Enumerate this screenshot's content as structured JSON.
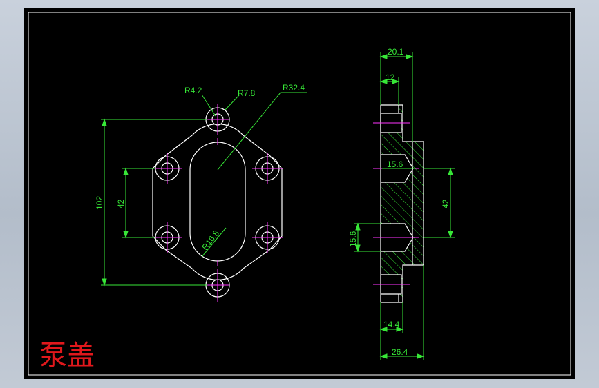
{
  "drawing": {
    "title": "泵盖",
    "colors": {
      "sheet": "#000000",
      "outline": "#ffffff",
      "dimension": "#37e637",
      "centerline": "#ff33ff",
      "title": "#e0181c"
    }
  },
  "front_view": {
    "dimensions": {
      "r_hole": "R4.2",
      "r_boss": "R7.8",
      "r_outer": "R32.4",
      "r_slot": "R16.8",
      "height_overall": "102",
      "hole_pitch": "42"
    }
  },
  "side_view": {
    "dimensions": {
      "width_top": "20.1",
      "width_mid": "12",
      "bore_upper": "15.6",
      "bore_lower": "15.6",
      "hole_pitch": "42",
      "boss_width": "14.4",
      "overall_width": "26.4"
    }
  }
}
